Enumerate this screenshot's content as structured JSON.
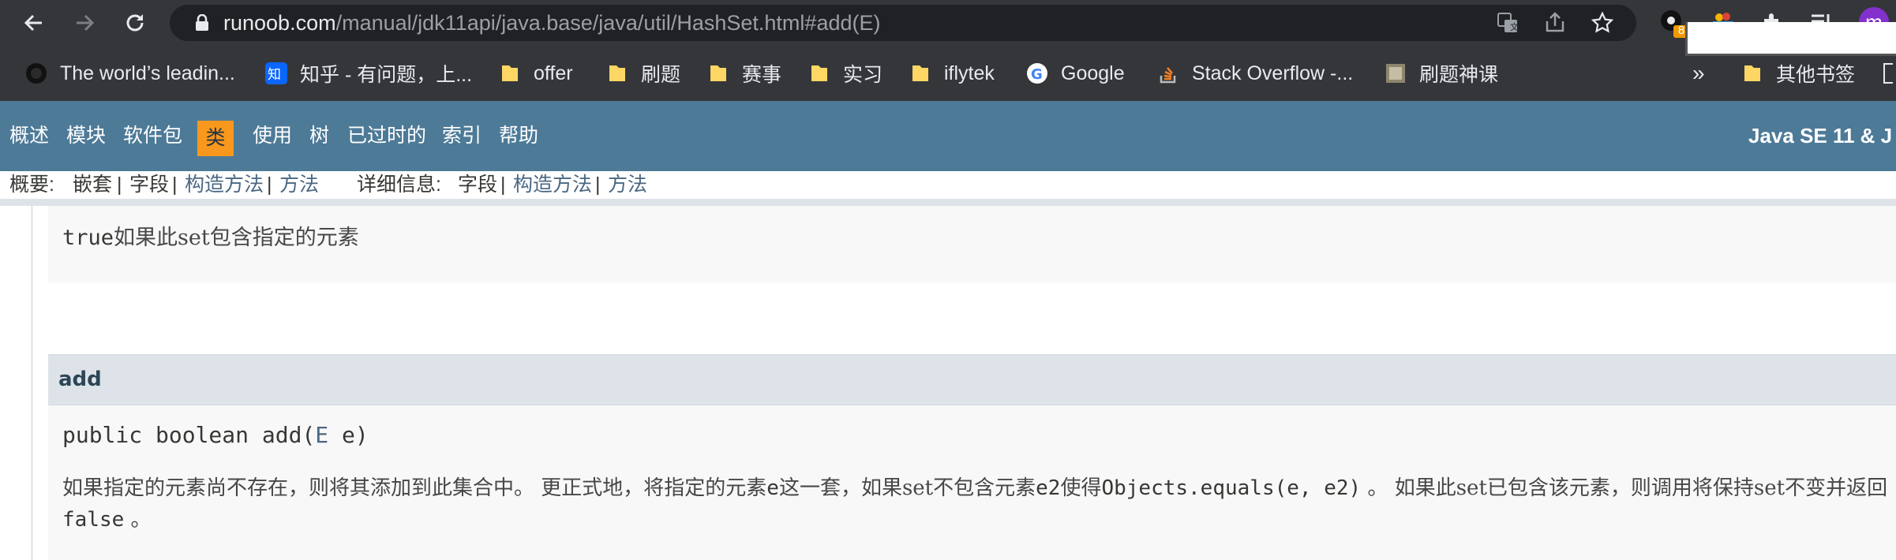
{
  "browser": {
    "url_domain": "runoob.com",
    "url_path": "/manual/jdk11api/java.base/java/util/HashSet.html#add(E)",
    "extension_badge": "8",
    "profile_initial": "m",
    "colors": {
      "toolbar_bg": "#35363a",
      "omnibox_bg": "#202124",
      "badge": "#f29900",
      "profile": "#8430ce"
    }
  },
  "bookmarks": {
    "items": [
      {
        "label": "The world’s leadin...",
        "icon": "github-icon"
      },
      {
        "label": "知乎 - 有问题，上...",
        "icon": "zhihu-icon"
      },
      {
        "label": "offer",
        "icon": "folder-icon"
      },
      {
        "label": "刷题",
        "icon": "folder-icon"
      },
      {
        "label": "赛事",
        "icon": "folder-icon"
      },
      {
        "label": "实习",
        "icon": "folder-icon"
      },
      {
        "label": "iflytek",
        "icon": "folder-icon"
      },
      {
        "label": "Google",
        "icon": "google-icon"
      },
      {
        "label": "Stack Overflow -...",
        "icon": "stackoverflow-icon"
      },
      {
        "label": "刷题神课",
        "icon": "page-icon"
      }
    ],
    "overflow": "»",
    "other": "其他书签"
  },
  "nav": {
    "items": [
      "概述",
      "模块",
      "软件包",
      "类",
      "使用",
      "树",
      "已过时的",
      "索引",
      "帮助"
    ],
    "active": "类",
    "title": "Java SE 11 & J",
    "colors": {
      "bg": "#4d7a97",
      "active_bg": "#f8981d"
    }
  },
  "subnav": {
    "summary_label": "概要:",
    "summary_nested": "嵌套",
    "summary_field": "字段",
    "summary_constructor": "构造方法",
    "summary_method": "方法",
    "sep": "|",
    "detail_label": "详细信息:",
    "detail_field": "字段",
    "detail_constructor": "构造方法",
    "detail_method": "方法"
  },
  "content": {
    "returns_code": "true",
    "returns_text": "如果此set包含指定的元素",
    "method_name": "add",
    "signature": {
      "prefix": "public boolean add(",
      "type": "E",
      "suffix": " e)"
    },
    "description": {
      "p1": "如果指定的元素尚不存在，则将其添加到此集合中。 更正式地，将指定的元素",
      "c1": "e",
      "p2": "这一套，如果set不包含元素",
      "c2": "e2",
      "p3": "使得",
      "c3": "Objects.equals(e, e2)",
      "p4": " 。 如果此set已包含该元素，则调用将保持set不变并返回",
      "c4": "false",
      "p5": " 。"
    }
  }
}
